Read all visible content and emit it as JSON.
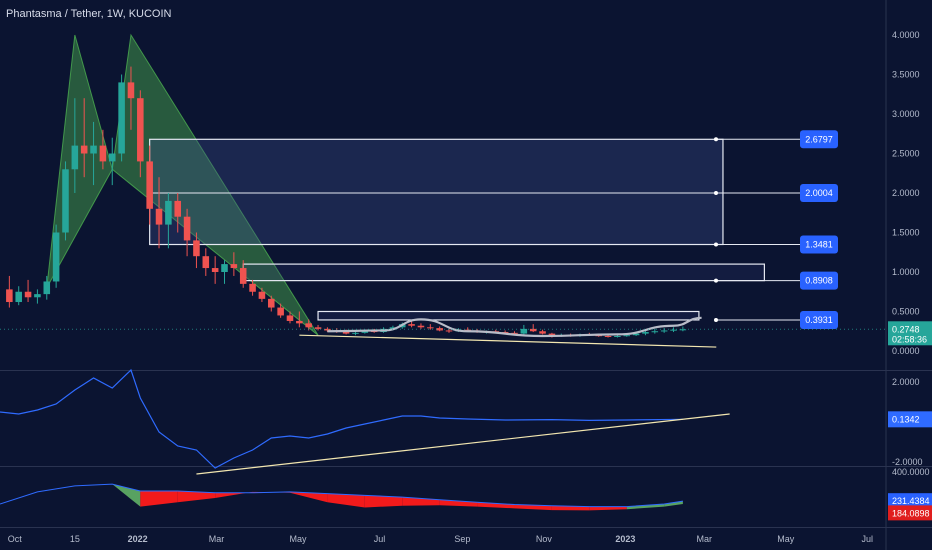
{
  "header": {
    "title": "Phantasma / Tether, 1W, KUCOIN"
  },
  "colors": {
    "background": "#0b1431",
    "bull": "#26a69a",
    "bear": "#ef5350",
    "pattern_fill": "#4caf50",
    "box_border": "#e6e9f2",
    "tag_blue": "#2962ff",
    "indicator_line": "#2f6bff",
    "hist_green": "#66bb6a",
    "hist_red": "#ff1a1a",
    "label_red": "#e01e1e"
  },
  "chart_data": [
    {
      "type": "candlestick",
      "title": "Phantasma / Tether, 1W, KUCOIN",
      "ylim": [
        0,
        4.2
      ],
      "xlim": [
        "2021-09-20",
        "2023-07-15"
      ],
      "y_ticks": [
        "4.0000",
        "3.5000",
        "3.0000",
        "2.5000",
        "2.0000",
        "1.5000",
        "1.0000",
        "0.5000",
        "0.0000"
      ],
      "x_ticks": [
        "Oct",
        "15",
        "2022",
        "Mar",
        "May",
        "Jul",
        "Sep",
        "Nov",
        "2023",
        "Mar",
        "May",
        "Jul"
      ],
      "last_price": {
        "label": "0.2748",
        "countdown": "02:58:36"
      },
      "candles": [
        [
          "2021-09-27",
          0.78,
          0.95,
          0.55,
          0.62
        ],
        [
          "2021-10-04",
          0.62,
          0.82,
          0.58,
          0.75
        ],
        [
          "2021-10-11",
          0.75,
          0.9,
          0.62,
          0.68
        ],
        [
          "2021-10-18",
          0.68,
          0.78,
          0.6,
          0.72
        ],
        [
          "2021-10-25",
          0.72,
          0.95,
          0.65,
          0.88
        ],
        [
          "2021-11-01",
          0.88,
          1.6,
          0.8,
          1.5
        ],
        [
          "2021-11-08",
          1.5,
          2.4,
          1.4,
          2.3
        ],
        [
          "2021-11-15",
          2.3,
          3.2,
          2.0,
          2.6
        ],
        [
          "2021-11-22",
          2.6,
          3.2,
          2.2,
          2.5
        ],
        [
          "2021-11-29",
          2.5,
          2.9,
          2.1,
          2.6
        ],
        [
          "2021-12-06",
          2.6,
          2.8,
          2.3,
          2.4
        ],
        [
          "2021-12-13",
          2.4,
          2.7,
          2.1,
          2.5
        ],
        [
          "2021-12-20",
          2.5,
          3.5,
          2.4,
          3.4
        ],
        [
          "2021-12-27",
          3.4,
          3.6,
          2.8,
          3.2
        ],
        [
          "2022-01-03",
          3.2,
          3.3,
          2.2,
          2.4
        ],
        [
          "2022-01-10",
          2.4,
          2.6,
          1.6,
          1.8
        ],
        [
          "2022-01-17",
          1.8,
          2.2,
          1.3,
          1.6
        ],
        [
          "2022-01-24",
          1.6,
          2.0,
          1.3,
          1.9
        ],
        [
          "2022-01-31",
          1.9,
          2.0,
          1.5,
          1.7
        ],
        [
          "2022-02-07",
          1.7,
          1.8,
          1.2,
          1.4
        ],
        [
          "2022-02-14",
          1.4,
          1.5,
          1.05,
          1.2
        ],
        [
          "2022-02-21",
          1.2,
          1.3,
          0.95,
          1.05
        ],
        [
          "2022-02-28",
          1.05,
          1.2,
          0.85,
          1.0
        ],
        [
          "2022-03-07",
          1.0,
          1.15,
          0.85,
          1.1
        ],
        [
          "2022-03-14",
          1.1,
          1.25,
          0.95,
          1.05
        ],
        [
          "2022-03-21",
          1.05,
          1.15,
          0.8,
          0.85
        ],
        [
          "2022-03-28",
          0.85,
          0.9,
          0.7,
          0.75
        ],
        [
          "2022-04-04",
          0.75,
          0.8,
          0.62,
          0.66
        ],
        [
          "2022-04-11",
          0.66,
          0.7,
          0.5,
          0.55
        ],
        [
          "2022-04-18",
          0.55,
          0.6,
          0.42,
          0.45
        ],
        [
          "2022-04-25",
          0.45,
          0.5,
          0.35,
          0.38
        ],
        [
          "2022-05-02",
          0.38,
          0.5,
          0.3,
          0.35
        ],
        [
          "2022-05-09",
          0.35,
          0.4,
          0.26,
          0.3
        ],
        [
          "2022-05-16",
          0.3,
          0.33,
          0.26,
          0.28
        ],
        [
          "2022-05-23",
          0.28,
          0.3,
          0.24,
          0.26
        ],
        [
          "2022-05-30",
          0.26,
          0.29,
          0.23,
          0.25
        ],
        [
          "2022-06-06",
          0.25,
          0.27,
          0.21,
          0.22
        ],
        [
          "2022-06-13",
          0.22,
          0.25,
          0.2,
          0.23
        ],
        [
          "2022-06-20",
          0.23,
          0.27,
          0.22,
          0.26
        ],
        [
          "2022-06-27",
          0.26,
          0.28,
          0.23,
          0.24
        ],
        [
          "2022-07-04",
          0.24,
          0.3,
          0.23,
          0.28
        ],
        [
          "2022-07-11",
          0.28,
          0.32,
          0.26,
          0.3
        ],
        [
          "2022-07-18",
          0.3,
          0.36,
          0.28,
          0.34
        ],
        [
          "2022-07-25",
          0.34,
          0.38,
          0.3,
          0.32
        ],
        [
          "2022-08-01",
          0.32,
          0.35,
          0.28,
          0.3
        ],
        [
          "2022-08-08",
          0.3,
          0.34,
          0.27,
          0.29
        ],
        [
          "2022-08-15",
          0.29,
          0.31,
          0.25,
          0.26
        ],
        [
          "2022-08-22",
          0.26,
          0.28,
          0.23,
          0.25
        ],
        [
          "2022-08-29",
          0.25,
          0.29,
          0.24,
          0.27
        ],
        [
          "2022-09-05",
          0.27,
          0.3,
          0.25,
          0.26
        ],
        [
          "2022-09-12",
          0.26,
          0.28,
          0.23,
          0.24
        ],
        [
          "2022-09-19",
          0.24,
          0.26,
          0.22,
          0.25
        ],
        [
          "2022-09-26",
          0.25,
          0.27,
          0.23,
          0.24
        ],
        [
          "2022-10-03",
          0.24,
          0.26,
          0.22,
          0.23
        ],
        [
          "2022-10-10",
          0.23,
          0.25,
          0.21,
          0.22
        ],
        [
          "2022-10-17",
          0.22,
          0.33,
          0.21,
          0.28
        ],
        [
          "2022-10-24",
          0.28,
          0.34,
          0.24,
          0.25
        ],
        [
          "2022-10-31",
          0.25,
          0.27,
          0.21,
          0.22
        ],
        [
          "2022-11-07",
          0.22,
          0.23,
          0.17,
          0.19
        ],
        [
          "2022-11-14",
          0.19,
          0.22,
          0.18,
          0.2
        ],
        [
          "2022-11-21",
          0.2,
          0.22,
          0.18,
          0.19
        ],
        [
          "2022-11-28",
          0.19,
          0.22,
          0.18,
          0.21
        ],
        [
          "2022-12-05",
          0.21,
          0.23,
          0.19,
          0.2
        ],
        [
          "2022-12-12",
          0.2,
          0.22,
          0.18,
          0.19
        ],
        [
          "2022-12-19",
          0.19,
          0.21,
          0.17,
          0.18
        ],
        [
          "2022-12-26",
          0.18,
          0.2,
          0.17,
          0.19
        ],
        [
          "2023-01-02",
          0.19,
          0.21,
          0.18,
          0.2
        ],
        [
          "2023-01-09",
          0.2,
          0.24,
          0.19,
          0.22
        ],
        [
          "2023-01-16",
          0.22,
          0.26,
          0.2,
          0.24
        ],
        [
          "2023-01-23",
          0.24,
          0.28,
          0.22,
          0.25
        ],
        [
          "2023-01-30",
          0.25,
          0.29,
          0.23,
          0.26
        ],
        [
          "2023-02-06",
          0.26,
          0.3,
          0.24,
          0.27
        ],
        [
          "2023-02-13",
          0.27,
          0.31,
          0.25,
          0.2748
        ]
      ],
      "harmonic_pattern": [
        [
          "2021-10-25",
          0.8
        ],
        [
          "2021-11-15",
          4.0
        ],
        [
          "2021-12-13",
          2.3
        ],
        [
          "2021-12-27",
          4.0
        ],
        [
          "2022-05-16",
          0.2
        ],
        [
          "2022-01-24",
          1.5
        ]
      ],
      "zones": [
        {
          "from": "2022-01-10",
          "to": "2023-03-15",
          "bottom": 1.3481,
          "top": 2.6797,
          "mid": 2.0004
        },
        {
          "from": "2022-03-21",
          "to": "2023-04-15",
          "bottom": 0.8908,
          "top": 1.1
        },
        {
          "from": "2022-05-16",
          "to": "2023-02-25",
          "bottom": 0.3931,
          "top": 0.5
        }
      ],
      "price_tags": [
        2.6797,
        2.0004,
        1.3481,
        0.8908,
        0.3931
      ],
      "price_tag_labels": [
        "2.6797",
        "2.0004",
        "1.3481",
        "0.8908",
        "0.3931"
      ],
      "support_line": [
        [
          "2022-05-02",
          0.2
        ],
        [
          "2023-03-10",
          0.05
        ]
      ],
      "rounding_curve": [
        [
          "2022-05-23",
          0.25
        ],
        [
          "2022-07-04",
          0.26
        ],
        [
          "2022-08-01",
          0.4
        ],
        [
          "2022-09-05",
          0.25
        ],
        [
          "2022-10-31",
          0.19
        ],
        [
          "2022-12-26",
          0.21
        ],
        [
          "2023-02-06",
          0.32
        ],
        [
          "2023-02-27",
          0.42
        ]
      ]
    },
    {
      "type": "line",
      "ylim": [
        -3.0,
        3.0
      ],
      "y_ticks": [
        "2.0000",
        "-2.0000"
      ],
      "last_value": "0.1342",
      "x": [
        "2021-09-20",
        "2021-10-04",
        "2021-10-18",
        "2021-11-01",
        "2021-11-15",
        "2021-11-29",
        "2021-12-13",
        "2021-12-27",
        "2022-01-03",
        "2022-01-17",
        "2022-01-31",
        "2022-02-14",
        "2022-02-28",
        "2022-03-14",
        "2022-03-28",
        "2022-04-11",
        "2022-04-25",
        "2022-05-09",
        "2022-05-23",
        "2022-06-06",
        "2022-06-20",
        "2022-07-04",
        "2022-07-18",
        "2022-08-01",
        "2022-08-15",
        "2022-09-05",
        "2022-10-03",
        "2022-11-07",
        "2022-12-05",
        "2023-01-02",
        "2023-02-13"
      ],
      "values": [
        0.5,
        0.4,
        0.6,
        0.9,
        1.6,
        2.2,
        1.7,
        2.6,
        1.2,
        -0.5,
        -1.2,
        -1.4,
        -2.3,
        -1.8,
        -1.4,
        -0.8,
        -0.7,
        -0.8,
        -0.6,
        -0.3,
        -0.1,
        0.1,
        0.3,
        0.3,
        0.2,
        0.15,
        0.1,
        0.12,
        0.08,
        0.1,
        0.1342
      ],
      "trendline": [
        [
          "2022-02-14",
          -2.6
        ],
        [
          "2023-03-20",
          0.4
        ]
      ]
    },
    {
      "type": "area",
      "ylim": [
        120,
        410
      ],
      "y_ticks": [
        "400.0000"
      ],
      "values_labels": [
        "231.4384",
        "184.0898"
      ],
      "x": [
        "2021-09-20",
        "2021-10-18",
        "2021-11-15",
        "2021-12-13",
        "2022-01-03",
        "2022-01-31",
        "2022-02-28",
        "2022-03-28",
        "2022-04-25",
        "2022-05-23",
        "2022-06-20",
        "2022-07-18",
        "2022-08-15",
        "2022-09-12",
        "2022-10-10",
        "2022-11-07",
        "2022-12-05",
        "2023-01-02",
        "2023-01-30",
        "2023-02-13"
      ],
      "upper": [
        215,
        285,
        320,
        330,
        290,
        290,
        280,
        280,
        285,
        275,
        265,
        255,
        240,
        225,
        212,
        205,
        200,
        200,
        215,
        232
      ],
      "lower": [
        215,
        285,
        320,
        330,
        200,
        225,
        250,
        285,
        280,
        225,
        195,
        205,
        208,
        200,
        190,
        180,
        178,
        185,
        200,
        215
      ]
    }
  ]
}
